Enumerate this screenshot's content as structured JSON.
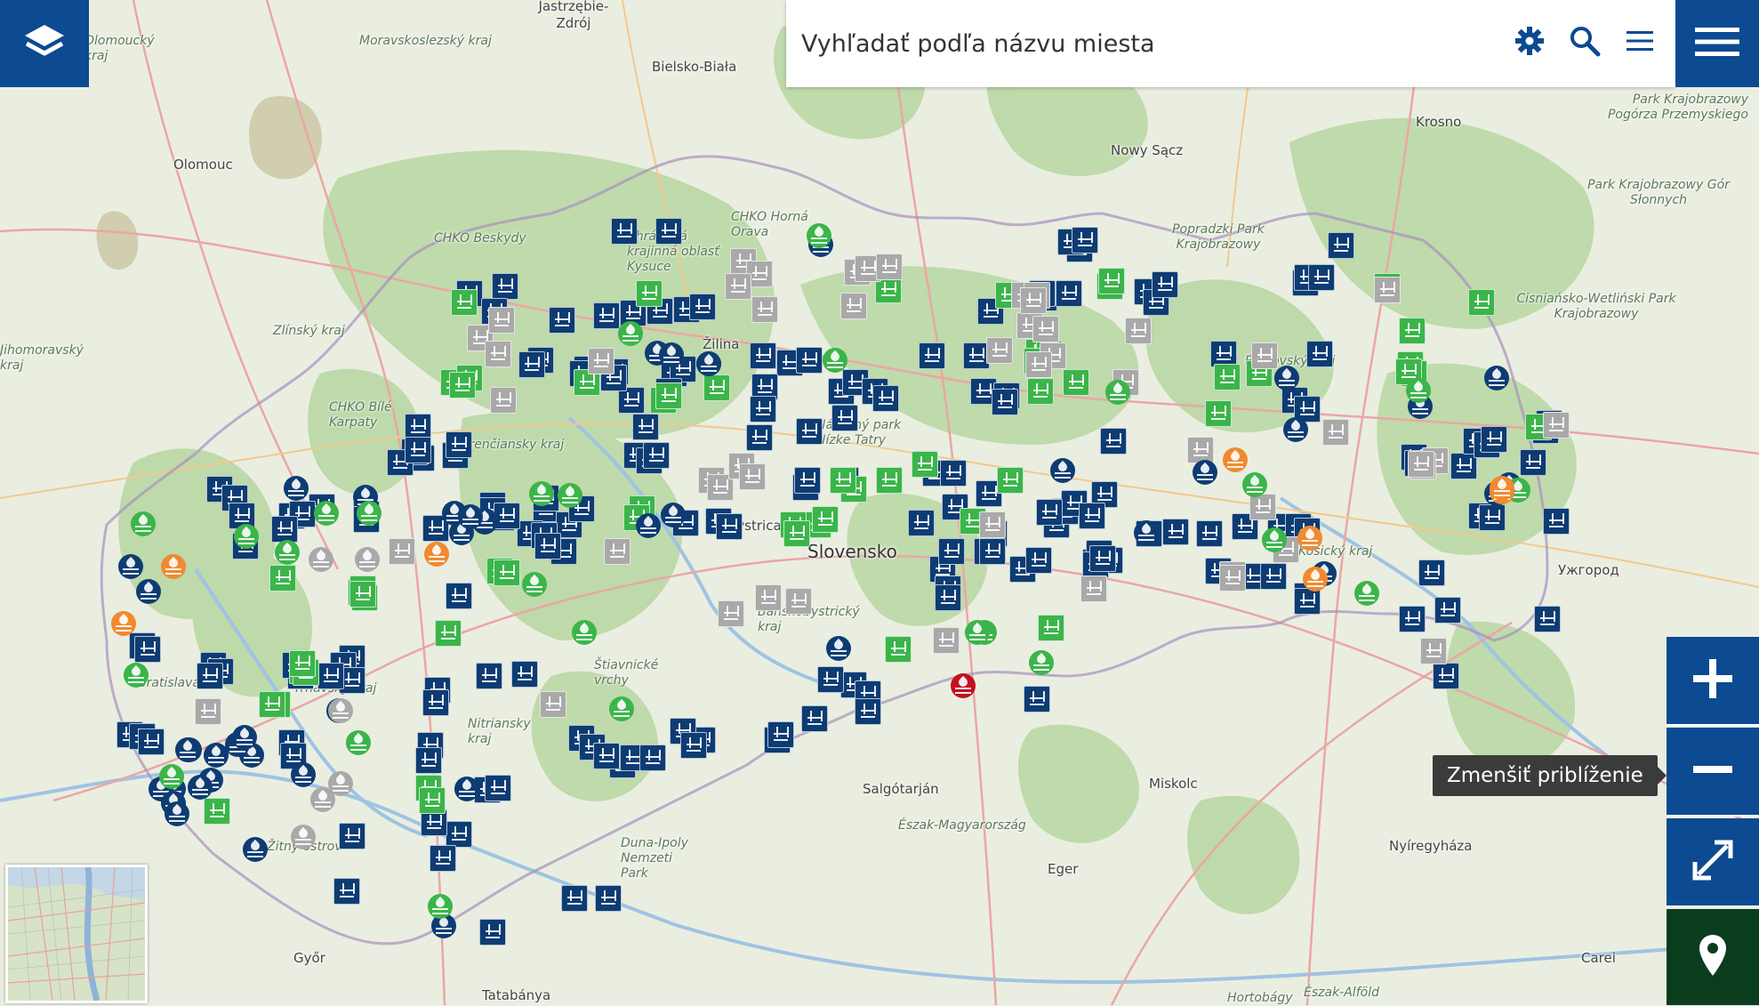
{
  "search": {
    "placeholder": "Vyhľadať podľa názvu miesta"
  },
  "tooltip": "Zmenšiť priblíženie",
  "colors": {
    "primary": "#0c4a91",
    "dark_green": "#0a3d1d",
    "pool": "#0d3c73",
    "green": "#3bb54a",
    "gray": "#a9a9a9",
    "orange": "#f08a30",
    "red": "#c0111f"
  },
  "icons": {
    "layers": "layers-icon",
    "settings": "gear-icon",
    "search": "search-icon",
    "list": "list-icon",
    "menu": "hamburger-icon",
    "zoom_in": "plus-icon",
    "zoom_out": "minus-icon",
    "fullscreen": "expand-icon",
    "location": "location-pin-icon"
  },
  "map_labels": [
    "Jastrzębie-Zdrój",
    "Olomoucký kraj",
    "Moravskoslezský kraj",
    "Bielsko-Biała",
    "Krosno",
    "Park Krajobrazowy Pogórza Przemyskiego",
    "Olomouc",
    "Nowy Sącz",
    "CHKO Horná Orava",
    "Chránená krajinná oblasť Kysuce",
    "CHKO Beskydy",
    "Popradzki Park Krajobrazowy",
    "Park Krajobrazowy Gór Słonnych",
    "Zlínský kraj",
    "Jihomoravský kraj",
    "Cisniańsko-Wetliński Park Krajobrazowy",
    "CHKO Bílé Karpaty",
    "Slovensko",
    "Ужгород",
    "Salgótarján",
    "Miskolc",
    "Nitriansky kraj",
    "Észak-Magyarország",
    "Duna-Ipoly Nemzeti Park",
    "Eger",
    "Nyíregyháza",
    "Győr",
    "Tatabánya",
    "Carei",
    "Hortobágy",
    "Észak-Alföld",
    "Bratislava",
    "Žitný ostrov",
    "Banskobystrický kraj",
    "Národný park Nízke Tatry",
    "Košický kraj",
    "Prešovský kraj",
    "Trenčiansky kraj",
    "Trnavský kraj",
    "Štiavnické vrchy",
    "Žilina",
    "Bystrica"
  ]
}
